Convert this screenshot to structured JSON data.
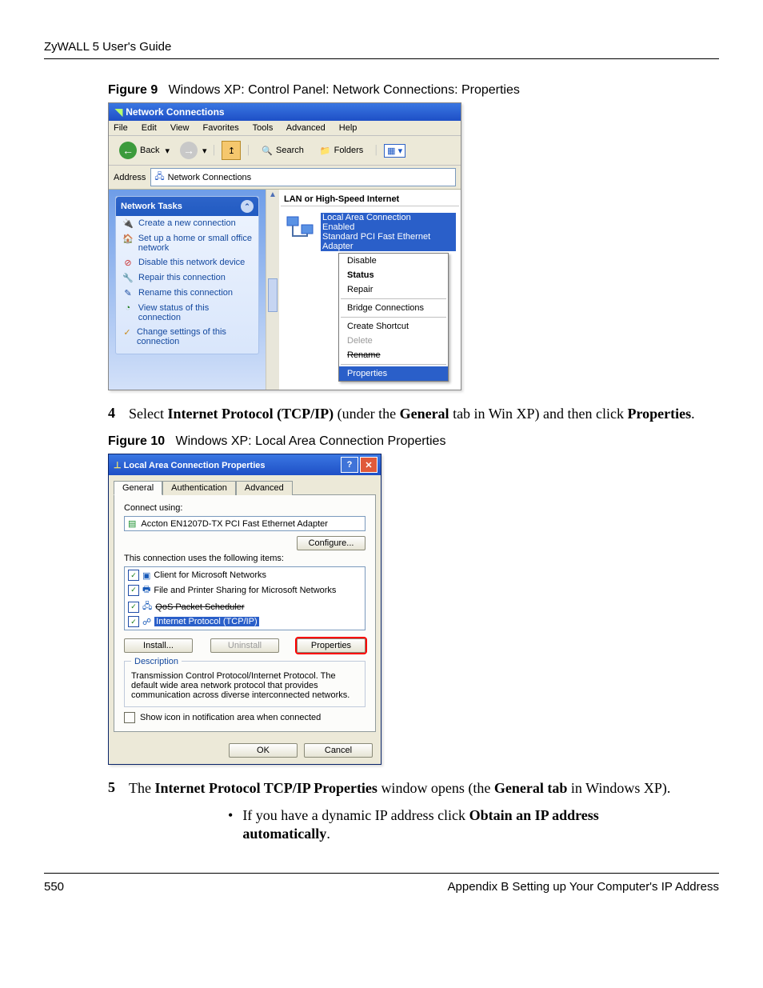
{
  "header": "ZyWALL 5 User's Guide",
  "fig9_caption_label": "Figure 9",
  "fig9_caption_text": "Windows XP: Control Panel: Network Connections: Properties",
  "fig9": {
    "title": "Network Connections",
    "menubar": [
      "File",
      "Edit",
      "View",
      "Favorites",
      "Tools",
      "Advanced",
      "Help"
    ],
    "toolbar": {
      "back": "Back",
      "search": "Search",
      "folders": "Folders"
    },
    "addressLabel": "Address",
    "addressValue": "Network Connections",
    "tasksTitle": "Network Tasks",
    "tasks": [
      "Create a new connection",
      "Set up a home or small office network",
      "Disable this network device",
      "Repair this connection",
      "Rename this connection",
      "View status of this connection",
      "Change settings of this connection"
    ],
    "group": "LAN or High-Speed Internet",
    "connName": "Local Area Connection",
    "connStatus": "Enabled",
    "connAdapter": "Standard PCI Fast Ethernet Adapter",
    "ctx": {
      "disable": "Disable",
      "status": "Status",
      "repair": "Repair",
      "bridge": "Bridge Connections",
      "shortcut": "Create Shortcut",
      "delete": "Delete",
      "rename": "Rename",
      "properties": "Properties"
    }
  },
  "step4_num": "4",
  "step4_text_a": "Select ",
  "step4_b1": "Internet Protocol (TCP/IP)",
  "step4_text_b": " (under the ",
  "step4_b2": "General",
  "step4_text_c": " tab in Win XP) and then click ",
  "step4_b3": "Properties",
  "step4_text_d": ".",
  "fig10_caption_label": "Figure 10",
  "fig10_caption_text": "Windows XP: Local Area Connection Properties",
  "fig10": {
    "title": "Local Area Connection Properties",
    "tabs": [
      "General",
      "Authentication",
      "Advanced"
    ],
    "connectLabel": "Connect using:",
    "adapter": "Accton EN1207D-TX PCI Fast Ethernet Adapter",
    "configure": "Configure...",
    "itemsLabel": "This connection uses the following items:",
    "items": [
      "Client for Microsoft Networks",
      "File and Printer Sharing for Microsoft Networks",
      "QoS Packet Scheduler",
      "Internet Protocol (TCP/IP)"
    ],
    "install": "Install...",
    "uninstall": "Uninstall",
    "properties": "Properties",
    "descLegend": "Description",
    "descText": "Transmission Control Protocol/Internet Protocol. The default wide area network protocol that provides communication across diverse interconnected networks.",
    "showIcon": "Show icon in notification area when connected",
    "ok": "OK",
    "cancel": "Cancel"
  },
  "step5_num": "5",
  "step5_text_a": "The ",
  "step5_b1": "Internet Protocol TCP/IP Properties",
  "step5_text_b": " window opens (the ",
  "step5_b2": "General tab",
  "step5_text_c": " in Windows XP).",
  "bullet_a": "If you have a dynamic IP address click ",
  "bullet_b": "Obtain an IP address automatically",
  "bullet_c": ".",
  "footer_page": "550",
  "footer_text": "Appendix B Setting up Your Computer's IP Address"
}
